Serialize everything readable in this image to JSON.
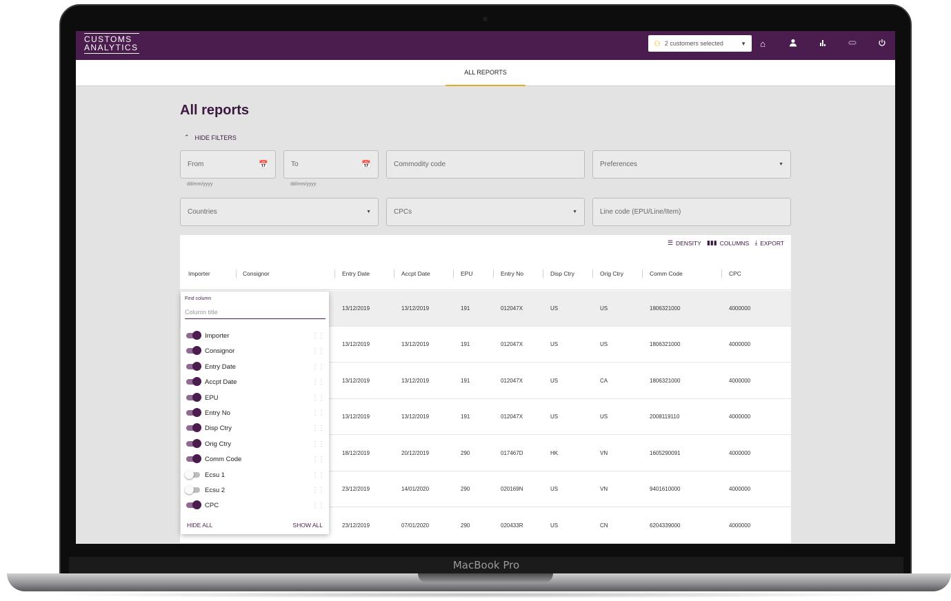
{
  "app": {
    "logo_line1": "CUSTOMS",
    "logo_line2": "ANALYTICS"
  },
  "header": {
    "customers_selected": "2 customers selected",
    "icons": [
      "people-icon",
      "home-icon",
      "user-icon",
      "bar-chart-icon",
      "link-icon",
      "power-icon"
    ]
  },
  "tabs": [
    {
      "label": "ALL REPORTS",
      "active": true
    }
  ],
  "page": {
    "title": "All reports",
    "hide_filters": "HIDE FILTERS"
  },
  "filters": {
    "from": "From",
    "to": "To",
    "date_hint": "dd/mm/yyyy",
    "commodity_code": "Commodity code",
    "preferences": "Preferences",
    "countries": "Countries",
    "cpcs": "CPCs",
    "line_code": "Line code (EPU/Line/Item)"
  },
  "toolbar": {
    "density": "DENSITY",
    "columns": "COLUMNS",
    "export": "EXPORT"
  },
  "table": {
    "columns": [
      "Importer",
      "Consignor",
      "Entry Date",
      "Accpt Date",
      "EPU",
      "Entry No",
      "Disp Ctry",
      "Orig Ctry",
      "Comm Code",
      "CPC"
    ],
    "rows": [
      [
        "13/12/2019",
        "13/12/2019",
        "191",
        "012047X",
        "US",
        "US",
        "1806321000",
        "4000000"
      ],
      [
        "13/12/2019",
        "13/12/2019",
        "191",
        "012047X",
        "US",
        "US",
        "1806321000",
        "4000000"
      ],
      [
        "13/12/2019",
        "13/12/2019",
        "191",
        "012047X",
        "US",
        "CA",
        "1806321000",
        "4000000"
      ],
      [
        "13/12/2019",
        "13/12/2019",
        "191",
        "012047X",
        "US",
        "US",
        "2008119110",
        "4000000"
      ],
      [
        "18/12/2019",
        "20/12/2019",
        "290",
        "017467D",
        "HK",
        "VN",
        "1605290091",
        "4000000"
      ],
      [
        "23/12/2019",
        "14/01/2020",
        "290",
        "020169N",
        "US",
        "VN",
        "9401610000",
        "4000000"
      ],
      [
        "23/12/2019",
        "07/01/2020",
        "290",
        "020433R",
        "US",
        "CN",
        "6204339000",
        "4000000"
      ]
    ]
  },
  "column_picker": {
    "find_label": "Find column",
    "placeholder": "Column title",
    "items": [
      {
        "label": "Importer",
        "on": true
      },
      {
        "label": "Consignor",
        "on": true
      },
      {
        "label": "Entry Date",
        "on": true
      },
      {
        "label": "Accpt Date",
        "on": true
      },
      {
        "label": "EPU",
        "on": true
      },
      {
        "label": "Entry No",
        "on": true
      },
      {
        "label": "Disp Ctry",
        "on": true
      },
      {
        "label": "Orig Ctry",
        "on": true
      },
      {
        "label": "Comm Code",
        "on": true
      },
      {
        "label": "Ecsu 1",
        "on": false
      },
      {
        "label": "Ecsu 2",
        "on": false
      },
      {
        "label": "CPC",
        "on": true
      }
    ],
    "hide_all": "HIDE ALL",
    "show_all": "SHOW ALL"
  },
  "device": {
    "label": "MacBook Pro"
  }
}
